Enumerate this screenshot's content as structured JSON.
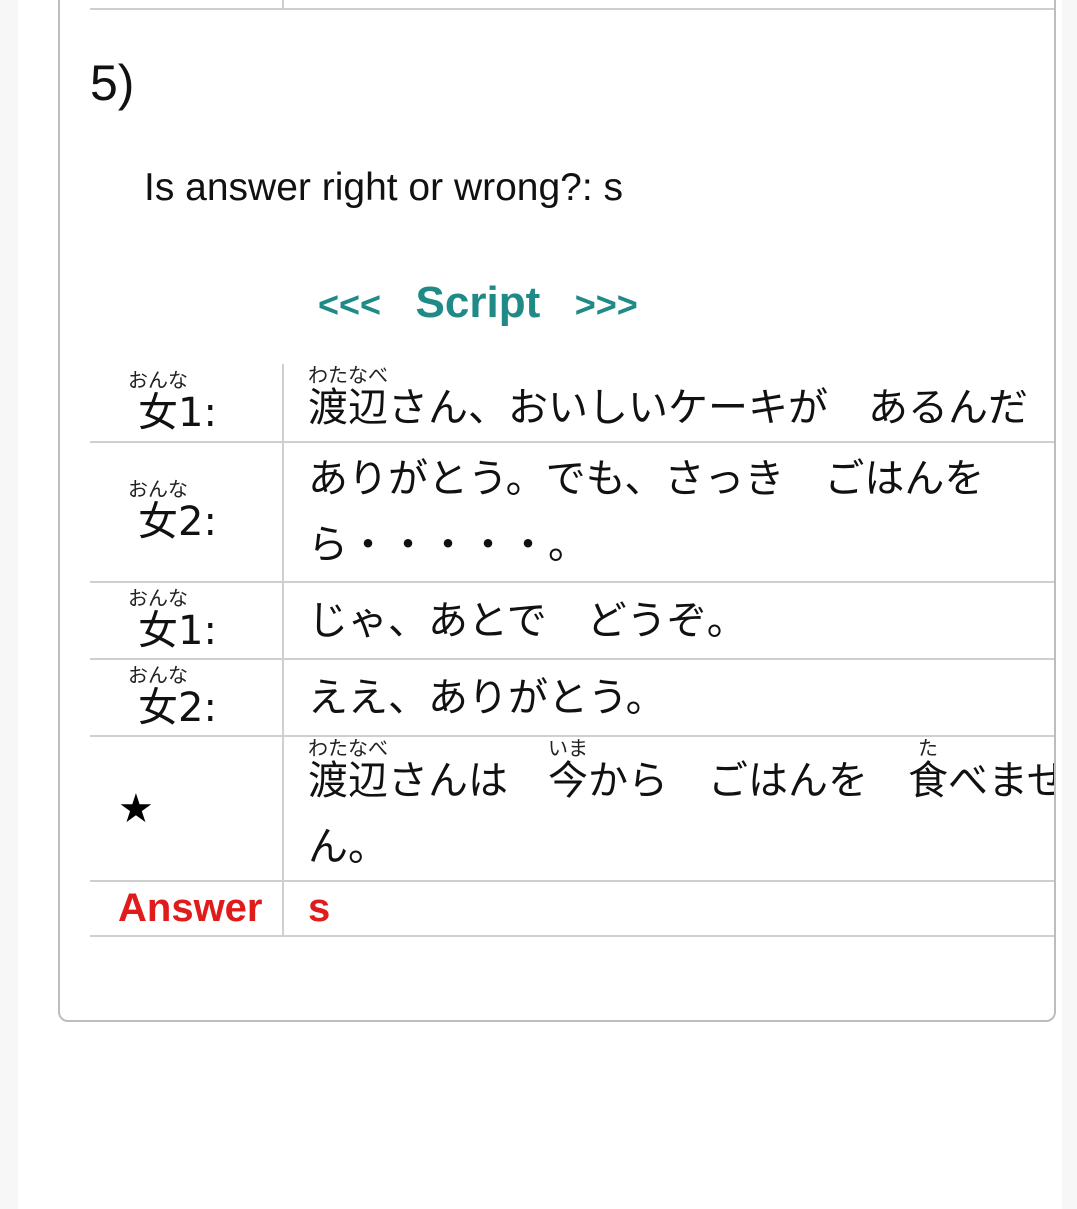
{
  "question": {
    "number": "5)",
    "prompt": "Is answer right or wrong?: s"
  },
  "script_nav": {
    "prev": "<<<",
    "title": "Script",
    "next": ">>>"
  },
  "speakers": {
    "f1_base": "女",
    "f2_base": "女",
    "reading": "おんな",
    "f1_suffix": "1:",
    "f2_suffix": "2:"
  },
  "lines": {
    "l1_kanji": "渡辺",
    "l1_ruby": "わたなべ",
    "l1_text": "さん、おいしいケーキが　あるんだ",
    "l2_text": "ありがとう。でも、さっき　ごはんを　ら・・・・・。",
    "l3_text": "じゃ、あとで　どうぞ。",
    "l4_text": "ええ、ありがとう。",
    "star_symbol": "★",
    "s_kanji1": "渡辺",
    "s_ruby1": "わたなべ",
    "s_text1": "さんは　",
    "s_kanji2": "今",
    "s_ruby2": "いま",
    "s_text2": "から　ごはんを　",
    "s_kanji3": "食",
    "s_ruby3": "た",
    "s_text3": "べません。"
  },
  "answer": {
    "label": "Answer",
    "value": "s"
  },
  "colors": {
    "accent": "#1f8a86",
    "answer": "#e01b1b"
  }
}
